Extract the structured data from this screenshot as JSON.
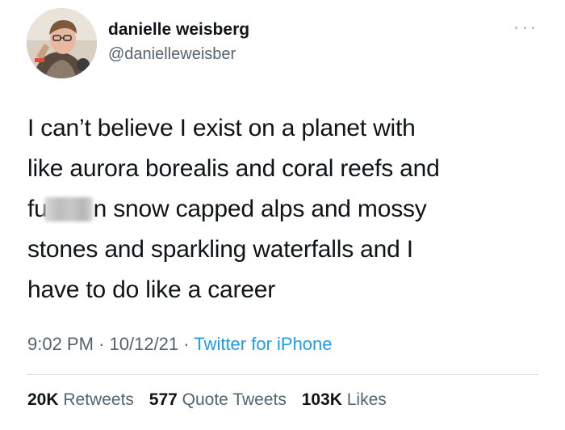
{
  "author": {
    "display_name": "danielle weisberg",
    "handle": "@danielleweisber",
    "avatar_icon": "profile-photo"
  },
  "tweet": {
    "lines": [
      "I can’t believe I exist on a planet with",
      "like aurora borealis and coral reefs and",
      "n snow capped alps and mossy",
      "stones and sparkling waterfalls and I",
      "have to do like a career"
    ],
    "line3_prefix": "fu",
    "censored_word_note": "blurred"
  },
  "meta": {
    "time": "9:02 PM",
    "separator": "·",
    "date": "10/12/21",
    "source": "Twitter for iPhone"
  },
  "stats": {
    "retweets_count": "20K",
    "retweets_label": "Retweets",
    "quotes_count": "577",
    "quotes_label": "Quote Tweets",
    "likes_count": "103K",
    "likes_label": "Likes"
  },
  "colors": {
    "text": "#0f1419",
    "secondary": "#536471",
    "link": "#1d9bf0",
    "divider": "#d7dde1"
  }
}
